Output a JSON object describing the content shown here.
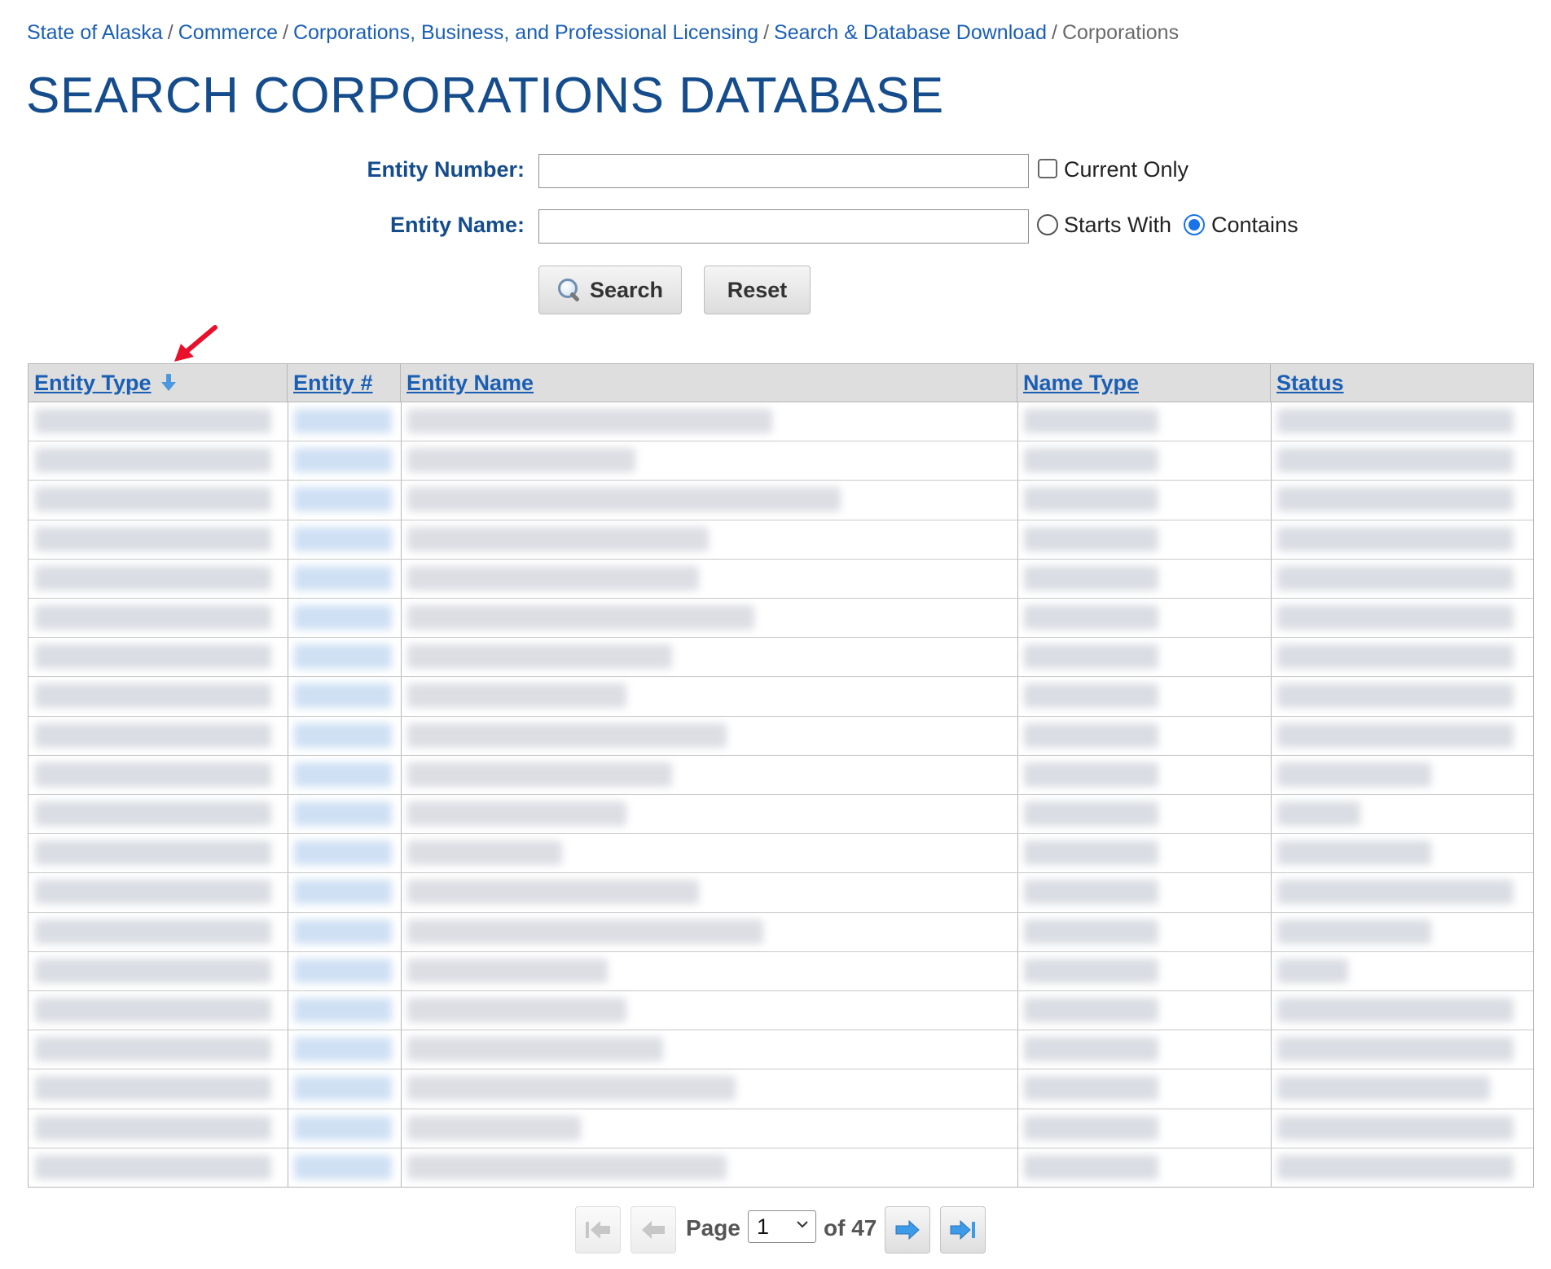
{
  "breadcrumb": {
    "items": [
      "State of Alaska",
      "Commerce",
      "Corporations, Business, and Professional Licensing",
      "Search & Database Download"
    ],
    "current": "Corporations",
    "separator": "/"
  },
  "page_title": "SEARCH CORPORATIONS DATABASE",
  "form": {
    "entity_number_label": "Entity Number:",
    "entity_number_value": "",
    "current_only_label": "Current Only",
    "current_only_checked": false,
    "entity_name_label": "Entity Name:",
    "entity_name_value": "",
    "match_options": [
      "Starts With",
      "Contains"
    ],
    "match_selected": "Contains",
    "search_button": "Search",
    "reset_button": "Reset"
  },
  "table": {
    "columns": [
      "Entity Type",
      "Entity #",
      "Entity Name",
      "Name Type",
      "Status"
    ],
    "sorted_column": "Entity Type",
    "sort_direction": "descending",
    "row_count": 20,
    "rows_obscured": true
  },
  "pager": {
    "page_label": "Page",
    "current_page": "1",
    "of_label": "of 47",
    "total_pages": 47
  },
  "colors": {
    "link": "#1a5fb4",
    "title": "#154c8c",
    "header_bg": "#dedede",
    "annotation_arrow": "#e8102a",
    "sort_arrow": "#4a98e0"
  },
  "icons": [
    "search-icon",
    "sort-down-arrow-icon",
    "first-page-icon",
    "previous-page-icon",
    "next-page-icon",
    "last-page-icon",
    "annotation-arrow-icon"
  ]
}
